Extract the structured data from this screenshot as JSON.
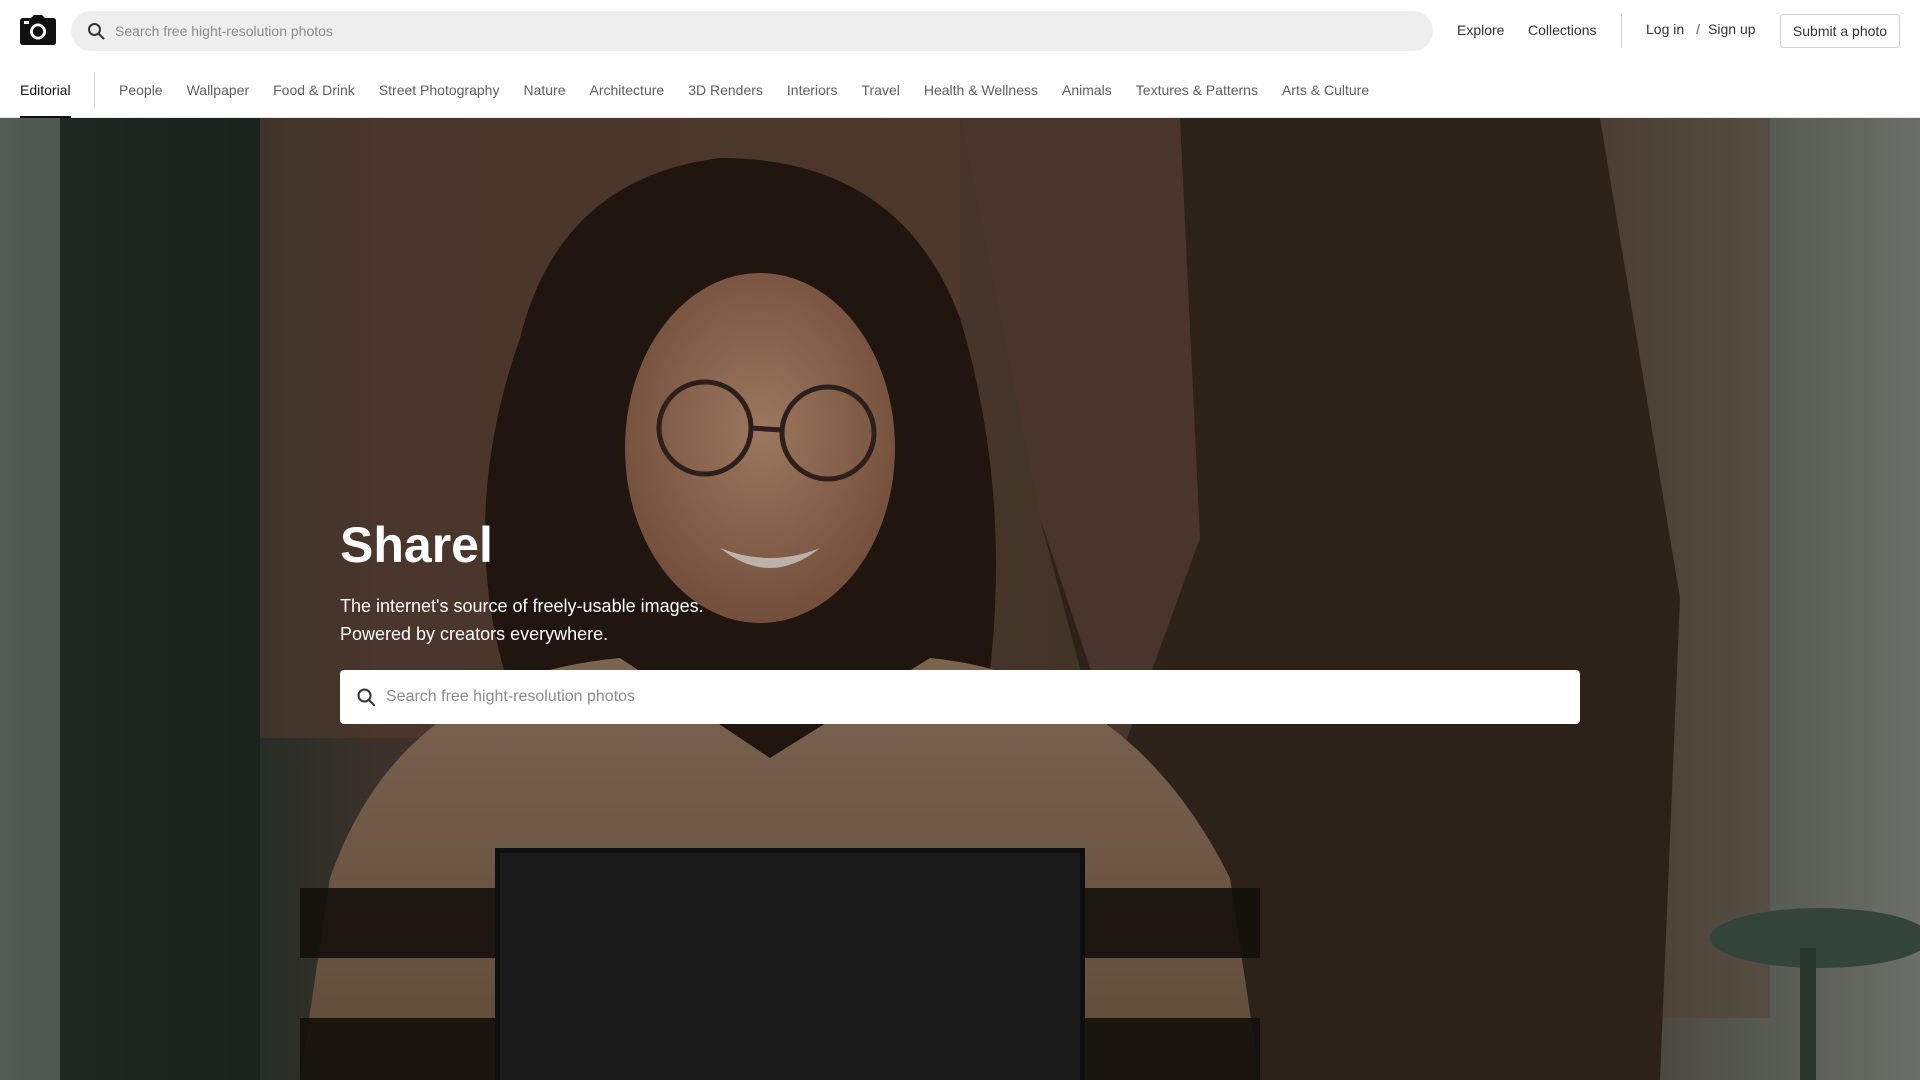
{
  "header": {
    "logo_icon": "camera-icon",
    "search": {
      "placeholder": "Search free hight-resolution photos",
      "value": "",
      "icon": "search-icon"
    },
    "nav": {
      "explore": "Explore",
      "collections": "Collections"
    },
    "auth": {
      "login": "Log in",
      "separator": "/",
      "signup": "Sign up"
    },
    "submit_label": "Submit a photo"
  },
  "categories": {
    "active": "Editorial",
    "items": [
      "People",
      "Wallpaper",
      "Food & Drink",
      "Street Photography",
      "Nature",
      "Architecture",
      "3D Renders",
      "Interiors",
      "Travel",
      "Health & Wellness",
      "Animals",
      "Textures & Patterns",
      "Arts & Culture"
    ]
  },
  "hero": {
    "title": "Sharel",
    "subtitle_line1": "The internet's source of freely-usable images.",
    "subtitle_line2": "Powered by creators everywhere.",
    "search": {
      "placeholder": "Search free hight-resolution photos",
      "value": "",
      "icon": "search-icon"
    }
  },
  "colors": {
    "accent": "#111111",
    "search_bg": "#eeeeee",
    "border": "#d1d1d1",
    "muted_text": "#5f5f5f"
  }
}
